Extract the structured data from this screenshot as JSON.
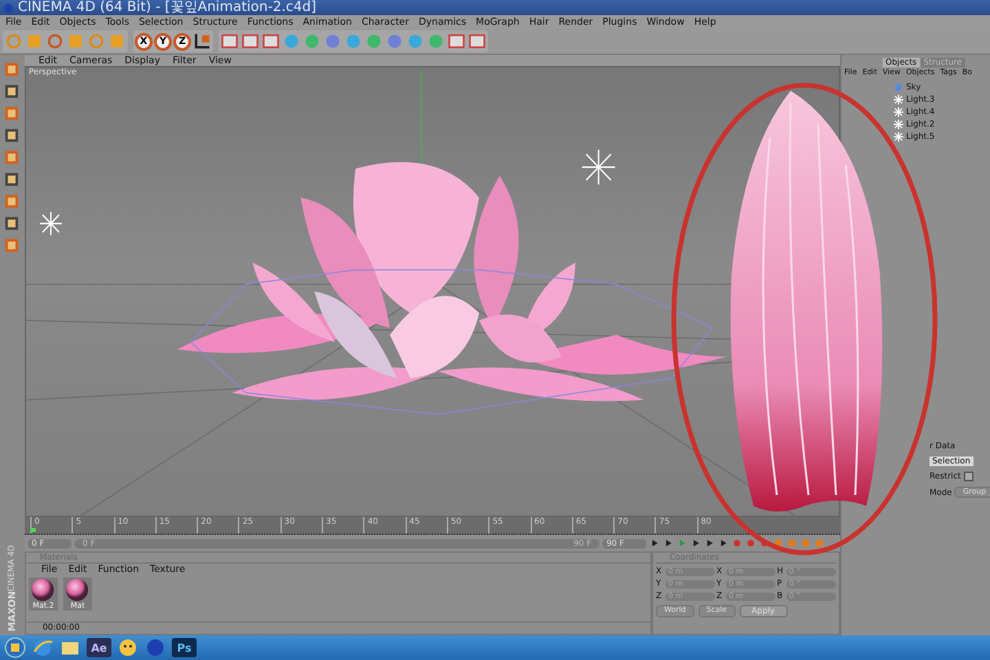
{
  "window": {
    "title": "CINEMA 4D (64 Bit) - [꽃잎Animation-2.c4d]"
  },
  "menu": [
    "File",
    "Edit",
    "Objects",
    "Tools",
    "Selection",
    "Structure",
    "Functions",
    "Animation",
    "Character",
    "Dynamics",
    "MoGraph",
    "Hair",
    "Render",
    "Plugins",
    "Window",
    "Help"
  ],
  "toolbar": {
    "axis_buttons": [
      "X",
      "Y",
      "Z"
    ]
  },
  "viewport": {
    "menu": [
      "Edit",
      "Cameras",
      "Display",
      "Filter",
      "View"
    ],
    "label": "Perspective"
  },
  "object_manager": {
    "tabs": [
      {
        "label": "Objects",
        "selected": true
      },
      {
        "label": "Structure",
        "selected": false
      }
    ],
    "menu": [
      "File",
      "Edit",
      "View",
      "Objects",
      "Tags",
      "Bo"
    ],
    "objects": [
      "Sky",
      "Light.3",
      "Light.4",
      "Light.2",
      "Light.5"
    ]
  },
  "attributes": {
    "title": "r Data",
    "tabs": [
      {
        "label": "Selection",
        "selected": true
      }
    ],
    "restrict": {
      "label": "Restrict",
      "checked": false
    },
    "mode": {
      "label": "Mode",
      "value": "Group"
    }
  },
  "timeline": {
    "ticks": [
      "0",
      "5",
      "10",
      "15",
      "20",
      "25",
      "30",
      "35",
      "40",
      "45",
      "50",
      "55",
      "60",
      "65",
      "70",
      "75",
      "80"
    ],
    "start": "0 F",
    "range_start": "0 F",
    "range_end": "90 F",
    "end": "90 F"
  },
  "materials": {
    "title": "Materials",
    "menu": [
      "File",
      "Edit",
      "Function",
      "Texture"
    ],
    "items": [
      "Mat.2",
      "Mat"
    ]
  },
  "coordinates": {
    "title": "Coordinates",
    "rows": [
      {
        "axis": "X",
        "position": "0 m",
        "size_axis": "X",
        "size": "0 m",
        "rot_axis": "H",
        "rotation": "0 °"
      },
      {
        "axis": "Y",
        "position": "0 m",
        "size_axis": "Y",
        "size": "0 m",
        "rot_axis": "P",
        "rotation": "0 °"
      },
      {
        "axis": "Z",
        "position": "0 m",
        "size_axis": "Z",
        "size": "0 m",
        "rot_axis": "B",
        "rotation": "0 °"
      }
    ],
    "space": "World",
    "mode": "Scale",
    "apply": "Apply"
  },
  "status": {
    "time": "00:00:00"
  },
  "logo": {
    "brand": "MAXON",
    "product": "CINEMA 4D"
  },
  "taskbar": {
    "apps": [
      "Ae",
      "Ps"
    ]
  }
}
